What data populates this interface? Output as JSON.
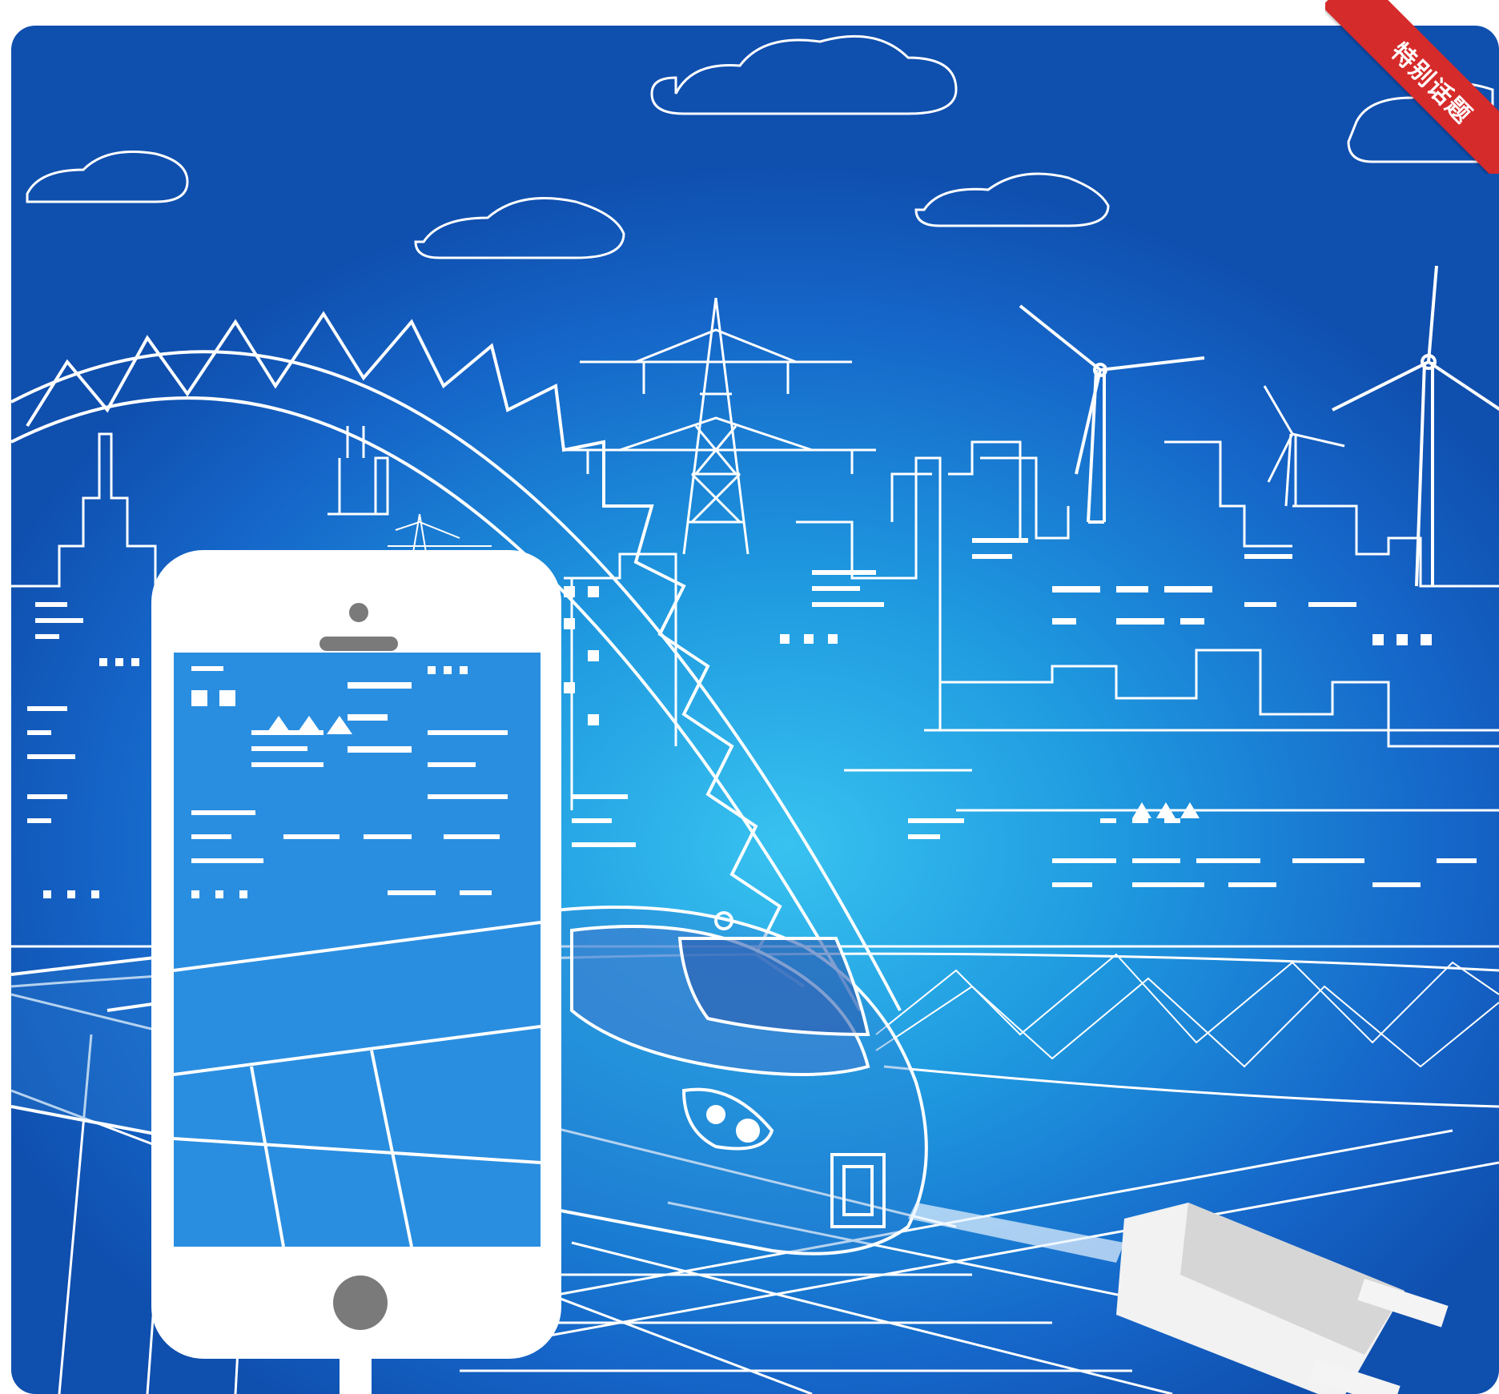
{
  "corner_ribbon": {
    "label": "特别话题",
    "color": "#d62b2b"
  },
  "colors": {
    "background_blue": "#1f9ae0",
    "line_white": "#ffffff",
    "device_white": "#ffffff",
    "button_gray": "#7a7a7a"
  }
}
